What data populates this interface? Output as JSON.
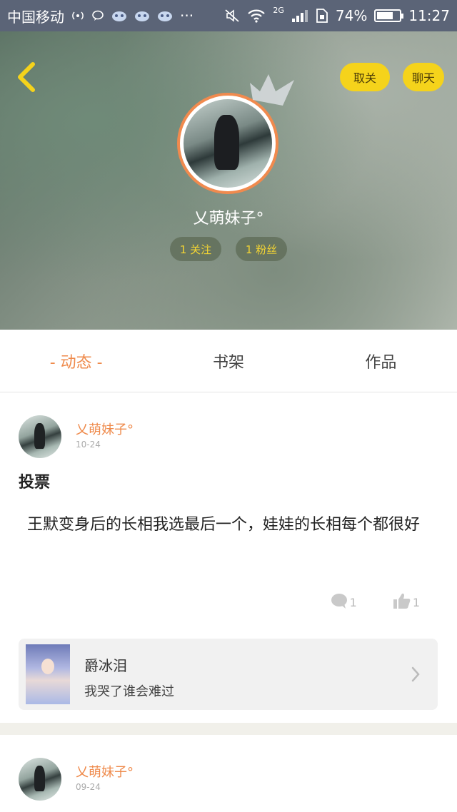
{
  "status_bar": {
    "carrier": "中国移动",
    "network": "2G",
    "battery_percent": "74%",
    "battery_level": 0.74,
    "time": "11:27",
    "more": "···"
  },
  "header": {
    "cancel_label": "取关",
    "chat_label": "聊天",
    "username": "乂萌妹子°",
    "follow_label": "1 关注",
    "fans_label": "1 粉丝"
  },
  "tabs": [
    {
      "label": "- 动态 -",
      "active": true
    },
    {
      "label": "书架",
      "active": false
    },
    {
      "label": "作品",
      "active": false
    }
  ],
  "posts": [
    {
      "user": "乂萌妹子°",
      "date": "10-24",
      "title": "投票",
      "body": "王默变身后的长相我选最后一个，娃娃的长相每个都很好",
      "comments": "1",
      "likes": "1",
      "book": {
        "title": "爵冰泪",
        "subtitle": "我哭了谁会难过"
      }
    },
    {
      "user": "乂萌妹子°",
      "date": "09-24"
    }
  ],
  "colors": {
    "accent": "#ef8a4b",
    "yellow": "#f5d31b",
    "status_bar": "#5b6477"
  }
}
